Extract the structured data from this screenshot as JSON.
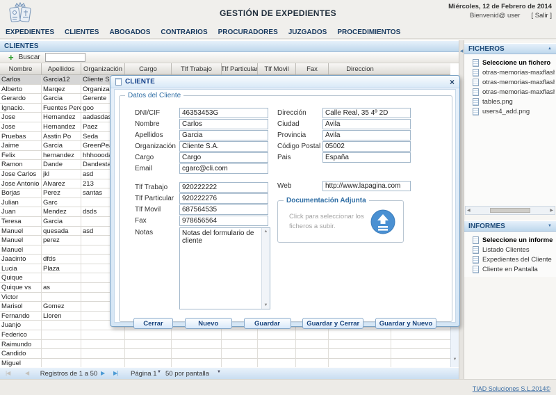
{
  "header": {
    "title": "GESTIÓN DE EXPEDIENTES",
    "date": "Miércoles, 12 de Febrero de 2014",
    "welcome": "Bienvenid@ user",
    "logout": "[ Salir ]"
  },
  "menu": {
    "items": [
      "EXPEDIENTES",
      "CLIENTES",
      "ABOGADOS",
      "CONTRARIOS",
      "PROCURADORES",
      "JUZGADOS",
      "PROCEDIMIENTOS"
    ]
  },
  "clients_panel": {
    "title": "CLIENTES",
    "search_label": "Buscar",
    "search_value": "",
    "columns": [
      "Nombre",
      "Apellidos",
      "Organización",
      "Cargo",
      "Tlf Trabajo",
      "Tlf Particular",
      "Tlf Movil",
      "Fax",
      "Direccion"
    ],
    "rows": [
      {
        "nombre": "Carlos",
        "apellidos": "Garcia12",
        "organizacion": "Cliente S.A.",
        "selected": true
      },
      {
        "nombre": "Alberto",
        "apellidos": "Marqez",
        "organizacion": "Organizacion"
      },
      {
        "nombre": "Gerardo",
        "apellidos": "Garcia",
        "organizacion": "Gerente"
      },
      {
        "nombre": "Ignacio.",
        "apellidos": "Fuentes Perez",
        "organizacion": "goo"
      },
      {
        "nombre": "Jose",
        "apellidos": "Hernandez",
        "organizacion": "aadasdasd"
      },
      {
        "nombre": "Jose",
        "apellidos": "Hernandez",
        "organizacion": "Paez"
      },
      {
        "nombre": "Pruebas",
        "apellidos": "Asstin Po",
        "organizacion": "Seda"
      },
      {
        "nombre": "Jaime",
        "apellidos": "Garcia",
        "organizacion": "GreenPea"
      },
      {
        "nombre": "Felix",
        "apellidos": "hernandez",
        "organizacion": "hhhoooda"
      },
      {
        "nombre": "Ramon",
        "apellidos": "Dande",
        "organizacion": "Dandesta"
      },
      {
        "nombre": "Jose Carlos",
        "apellidos": "jkl",
        "organizacion": "asd"
      },
      {
        "nombre": "Jose Antonio",
        "apellidos": "Alvarez",
        "organizacion": "213"
      },
      {
        "nombre": "Borjas",
        "apellidos": "Perez",
        "organizacion": "santas"
      },
      {
        "nombre": "Julian",
        "apellidos": "Garc",
        "organizacion": ""
      },
      {
        "nombre": "Juan",
        "apellidos": "Mendez",
        "organizacion": "dsds"
      },
      {
        "nombre": "Teresa",
        "apellidos": "Garcia",
        "organizacion": ""
      },
      {
        "nombre": "Manuel",
        "apellidos": "quesada",
        "organizacion": "asd"
      },
      {
        "nombre": "Manuel",
        "apellidos": "perez",
        "organizacion": ""
      },
      {
        "nombre": "Manuel",
        "apellidos": "",
        "organizacion": ""
      },
      {
        "nombre": "Jaacinto",
        "apellidos": "dfds",
        "organizacion": ""
      },
      {
        "nombre": "Lucia",
        "apellidos": "Plaza",
        "organizacion": ""
      },
      {
        "nombre": "Quique",
        "apellidos": "",
        "organizacion": ""
      },
      {
        "nombre": "Quique vs",
        "apellidos": "as",
        "organizacion": ""
      },
      {
        "nombre": "Victor",
        "apellidos": "",
        "organizacion": ""
      },
      {
        "nombre": "Marisol",
        "apellidos": "Gomez",
        "organizacion": ""
      },
      {
        "nombre": "Fernando",
        "apellidos": "Lloren",
        "organizacion": ""
      },
      {
        "nombre": "Juanjo",
        "apellidos": "",
        "organizacion": ""
      },
      {
        "nombre": "Federico",
        "apellidos": "",
        "organizacion": ""
      },
      {
        "nombre": "Raimundo",
        "apellidos": "",
        "organizacion": ""
      },
      {
        "nombre": "Candido",
        "apellidos": "",
        "organizacion": ""
      },
      {
        "nombre": "Miguel",
        "apellidos": "",
        "organizacion": ""
      }
    ],
    "pagination": {
      "records": "Registros de 1 a 50",
      "page": "Página 1",
      "per_page": "50 por pantalla"
    }
  },
  "dialog": {
    "title": "CLIENTE",
    "section": "Datos del Cliente",
    "fields": {
      "dni": {
        "label": "DNI/CIF",
        "value": "46353453G"
      },
      "nombre": {
        "label": "Nombre",
        "value": "Carlos"
      },
      "apellidos": {
        "label": "Apellidos",
        "value": "Garcia"
      },
      "organizacion": {
        "label": "Organización",
        "value": "Cliente S.A."
      },
      "cargo": {
        "label": "Cargo",
        "value": "Cargo"
      },
      "email": {
        "label": "Email",
        "value": "cgarc@cli.com"
      },
      "tlf_trabajo": {
        "label": "Tlf Trabajo",
        "value": "920222222"
      },
      "tlf_particular": {
        "label": "Tlf Particular",
        "value": "920222276"
      },
      "tlf_movil": {
        "label": "Tlf Movil",
        "value": "687564535"
      },
      "fax": {
        "label": "Fax",
        "value": "978656564"
      },
      "notas": {
        "label": "Notas",
        "value": "Notas del formulario de cliente"
      },
      "direccion": {
        "label": "Dirección",
        "value": "Calle Real, 35 4º 2D"
      },
      "ciudad": {
        "label": "Ciudad",
        "value": "Avila"
      },
      "provincia": {
        "label": "Provincia",
        "value": "Avila"
      },
      "codigo_postal": {
        "label": "Código Postal",
        "value": "05002"
      },
      "pais": {
        "label": "Pais",
        "value": "España"
      },
      "web": {
        "label": "Web",
        "value": "http://www.lapagina.com"
      }
    },
    "upload": {
      "legend": "Documentación Adjunta",
      "hint_line1": "Click para seleccionar los",
      "hint_line2": "ficheros a subir."
    },
    "buttons": [
      "Cerrar",
      "Nuevo",
      "Guardar",
      "Guardar y Cerrar",
      "Guardar y Nuevo"
    ]
  },
  "sidebar": {
    "ficheros": {
      "title": "FICHEROS",
      "items": [
        {
          "label": "Seleccione un fichero",
          "bold": true
        },
        {
          "label": "otras-memorias-maxflash-sd-hc"
        },
        {
          "label": "otras-memorias-maxflash-sd-hc"
        },
        {
          "label": "otras-memorias-maxflash-sd-hc"
        },
        {
          "label": "tables.png"
        },
        {
          "label": "users4_add.png"
        }
      ]
    },
    "informes": {
      "title": "INFORMES",
      "items": [
        {
          "label": "Seleccione un informe",
          "bold": true
        },
        {
          "label": "Listado Clientes"
        },
        {
          "label": "Expedientes del Cliente"
        },
        {
          "label": "Cliente en Pantalla"
        }
      ]
    }
  },
  "footer": {
    "link": "TIAD Soluciones S.L.2014©"
  },
  "icons": {
    "add": "+",
    "close": "×",
    "collapse": "▲",
    "expand": "▼",
    "left": "◀",
    "right": "▶",
    "up": "▲",
    "down": "▼",
    "first": "|◀",
    "prev": "◀",
    "next": "▶",
    "last": "▶|",
    "caret": "▼"
  },
  "colors": {
    "accent_blue": "#bed7ec",
    "title_navy": "#15428b",
    "upload_icon_blue": "#4a90d2",
    "selected_row": "#d6d6d6",
    "link_blue": "#3b6ea5"
  }
}
